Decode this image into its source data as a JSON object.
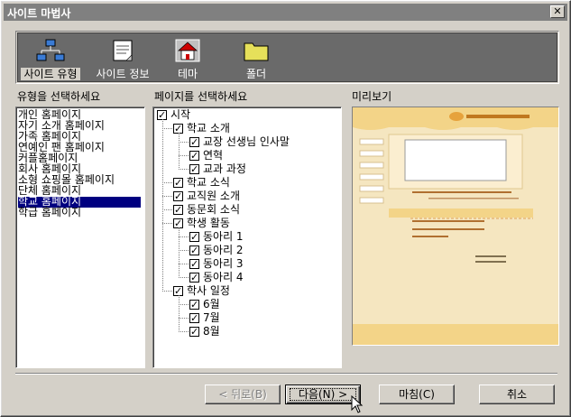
{
  "window": {
    "title": "사이트 마법사"
  },
  "toolbar": {
    "items": [
      {
        "label": "사이트 유형",
        "icon": "network-icon",
        "selected": true
      },
      {
        "label": "사이트 정보",
        "icon": "notepad-icon",
        "selected": false
      },
      {
        "label": "테마",
        "icon": "home-icon",
        "selected": false
      },
      {
        "label": "폴더",
        "icon": "folder-icon",
        "selected": false
      }
    ]
  },
  "types": {
    "label": "유형을 선택하세요",
    "items": [
      "개인 홈페이지",
      "자기 소개 홈페이지",
      "가족 홈페이지",
      "연예인 팬 홈페이지",
      "커플홈페이지",
      "회사 홈페이지",
      "소형 쇼핑몰 홈페이지",
      "단체 홈페이지",
      "학교 홈페이지",
      "학급 홈페이지"
    ],
    "selected_index": 8
  },
  "pages": {
    "label": "페이지를 선택하세요",
    "tree": [
      {
        "label": "시작",
        "level": 0
      },
      {
        "label": "학교 소개",
        "level": 1
      },
      {
        "label": "교장 선생님 인사말",
        "level": 2
      },
      {
        "label": "연혁",
        "level": 2
      },
      {
        "label": "교과 과정",
        "level": 2
      },
      {
        "label": "학교 소식",
        "level": 1
      },
      {
        "label": "교직원 소개",
        "level": 1
      },
      {
        "label": "동문회 소식",
        "level": 1
      },
      {
        "label": "학생 활동",
        "level": 1
      },
      {
        "label": "동아리 1",
        "level": 2
      },
      {
        "label": "동아리 2",
        "level": 2
      },
      {
        "label": "동아리 3",
        "level": 2
      },
      {
        "label": "동아리 4",
        "level": 2
      },
      {
        "label": "학사 일정",
        "level": 1
      },
      {
        "label": "6월",
        "level": 2
      },
      {
        "label": "7월",
        "level": 2
      },
      {
        "label": "8월",
        "level": 2
      }
    ]
  },
  "preview": {
    "label": "미리보기"
  },
  "buttons": {
    "back": "< 뒤로(B)",
    "next": "다음(N) >",
    "finish": "마침(C)",
    "cancel": "취소"
  },
  "colors": {
    "title_bar": "#808080",
    "toolbar_bg": "#6a6a6a",
    "selection": "#000080",
    "preview_bg": "#f5e6c0"
  }
}
